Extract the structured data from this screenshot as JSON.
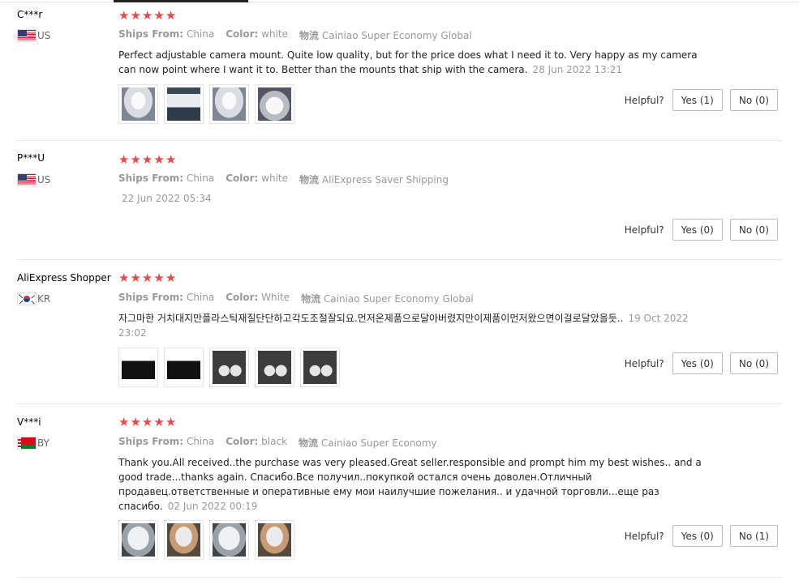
{
  "reviews": [
    {
      "user": "C***r",
      "country": "US",
      "flag": "us",
      "rating": 5,
      "ships_from_label": "Ships From:",
      "ships_from": "China",
      "color_label": "Color:",
      "color": "white",
      "shipping_label": "物流",
      "shipping": "Cainiao Super Economy Global",
      "text": "Perfect adjustable camera mount. Quite low quality, but for the price does what I need it to. Very happy as my camera can now point where I want it to. Better than the mounts that ship with the camera.",
      "date": "28 Jun 2022 13:21",
      "photos": [
        "mount-photo",
        "camera-photo",
        "mount-photo",
        "white-mount-photo"
      ],
      "helpful_label": "Helpful?",
      "yes": "Yes (1)",
      "no": "No (0)"
    },
    {
      "user": "P***U",
      "country": "US",
      "flag": "us",
      "rating": 5,
      "ships_from_label": "Ships From:",
      "ships_from": "China",
      "color_label": "Color:",
      "color": "white",
      "shipping_label": "物流",
      "shipping": "AliExpress Saver Shipping",
      "date": "22 Jun 2022 05:34",
      "helpful_label": "Helpful?",
      "yes": "Yes (0)",
      "no": "No (0)"
    },
    {
      "user": "AliExpress Shopper",
      "country": "KR",
      "flag": "kr",
      "rating": 5,
      "ships_from_label": "Ships From:",
      "ships_from": "China",
      "color_label": "Color:",
      "color": "White",
      "shipping_label": "物流",
      "shipping": "Cainiao Super Economy Global",
      "text": "자그마한 거치대지만플라스틱재질단단하고각도조절잘되요.먼저온제품으로달아버렸지만이제품이먼저왔으면이걸로달았을듯..",
      "date": "19 Oct 2022 23:02",
      "photos": [
        "box-photo",
        "box-photo",
        "dark-mount-photo",
        "dark-mount-photo",
        "dark-mount-photo"
      ],
      "helpful_label": "Helpful?",
      "yes": "Yes (0)",
      "no": "No (0)"
    },
    {
      "user": "V***i",
      "country": "BY",
      "flag": "by",
      "rating": 5,
      "ships_from_label": "Ships From:",
      "ships_from": "China",
      "color_label": "Color:",
      "color": "black",
      "shipping_label": "物流",
      "shipping": "Cainiao Super Economy",
      "text": "Thank you.All received..the purchase was very pleased.Great seller.responsible and prompt him my best wishes.. and a good trade...thanks again. Спасибо.Все получил..покупкой остался очень доволен.Отличный продавец.ответственные и оперативные ему мои наилучшие пожелания.. и удачной торговли...еще раз спасибо.",
      "date": "02 Jun 2022 00:19",
      "photos": [
        "bag-photo",
        "hand-photo",
        "bag-photo",
        "hand-photo"
      ],
      "helpful_label": "Helpful?",
      "yes": "Yes (0)",
      "no": "No (1)"
    }
  ]
}
